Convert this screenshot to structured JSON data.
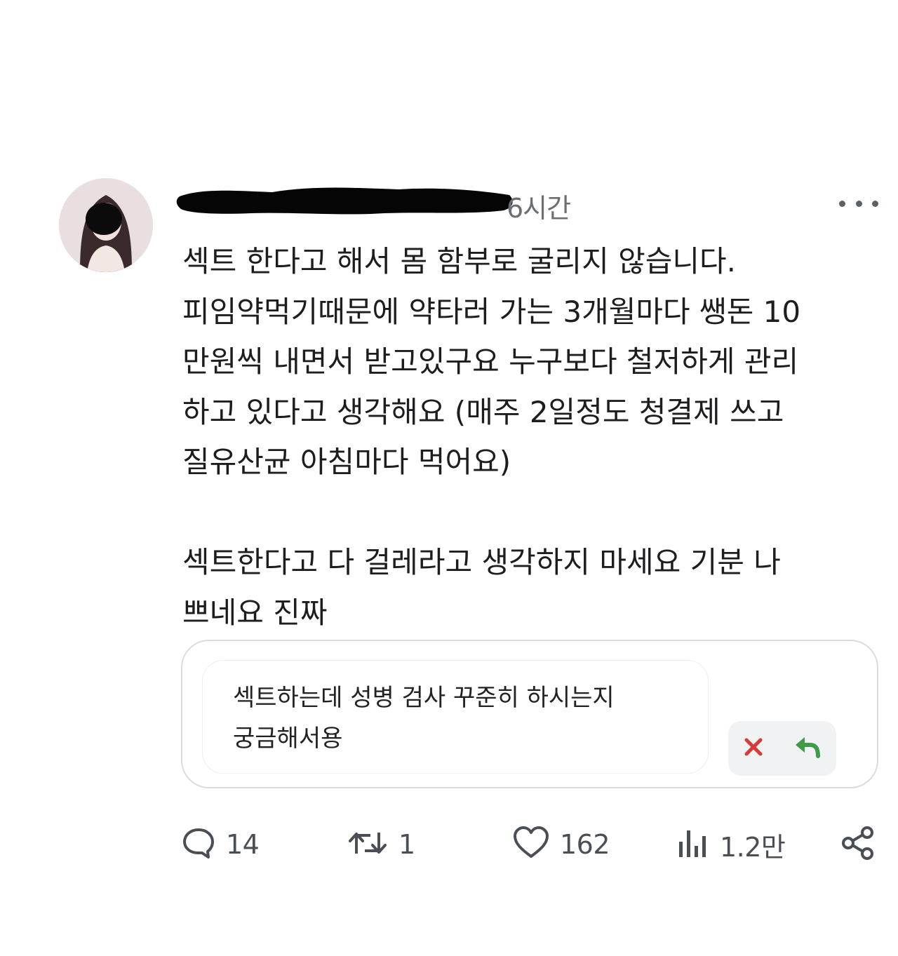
{
  "post": {
    "timestamp": "6시간",
    "text_lines": [
      "섹트 한다고 해서 몸 함부로 굴리지 않습니다.",
      "피임약먹기때문에 약타러 가는 3개월마다 쌩돈 10",
      "만원씩 내면서 받고있구요 누구보다 철저하게 관리",
      "하고 있다고 생각해요 (매주 2일정도 청결제 쓰고",
      "질유산균 아침마다 먹어요)",
      "",
      "섹트한다고 다 걸레라고 생각하지 마세요 기분 나",
      "쁘네요 진짜"
    ]
  },
  "quoted_message": {
    "text_lines": [
      "섹트하는데 성병 검사 꾸준히 하시는지",
      "궁금해서용"
    ]
  },
  "actions": {
    "replies": "14",
    "retweets": "1",
    "likes": "162",
    "views": "1.2만"
  },
  "icons": {
    "reply": "speech-bubble-icon",
    "retweet": "retweet-icon",
    "like": "heart-icon",
    "views": "bar-chart-icon",
    "share": "share-icon",
    "reject": "x-icon",
    "answer": "reply-arrow-icon"
  },
  "colors": {
    "reject": "#d83a3a",
    "answer": "#3f9a4a",
    "icon_gray": "#4a4f55"
  }
}
